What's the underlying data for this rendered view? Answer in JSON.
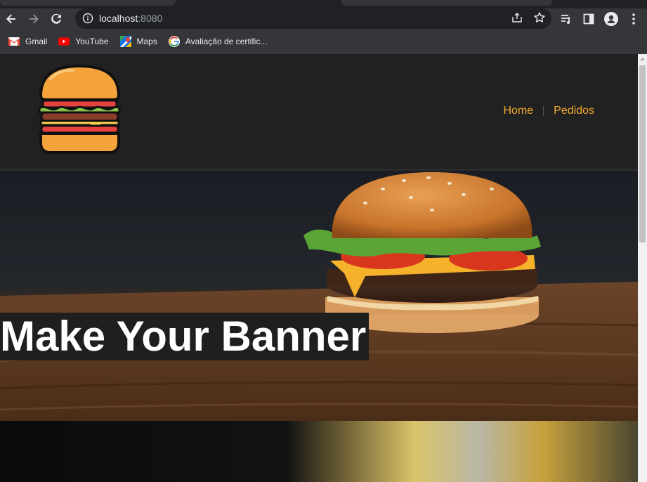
{
  "browser": {
    "url_host": "localhost",
    "url_port": ":8080",
    "bookmarks": [
      {
        "label": "Gmail",
        "icon": "gmail-icon"
      },
      {
        "label": "YouTube",
        "icon": "youtube-icon"
      },
      {
        "label": "Maps",
        "icon": "maps-icon"
      },
      {
        "label": "Avaliação de certific...",
        "icon": "google-icon"
      }
    ]
  },
  "site": {
    "nav": {
      "home": "Home",
      "orders": "Pedidos"
    },
    "banner_title": "Make Your Banner",
    "colors": {
      "accent": "#f4ab2f",
      "header_bg": "#212121"
    }
  }
}
